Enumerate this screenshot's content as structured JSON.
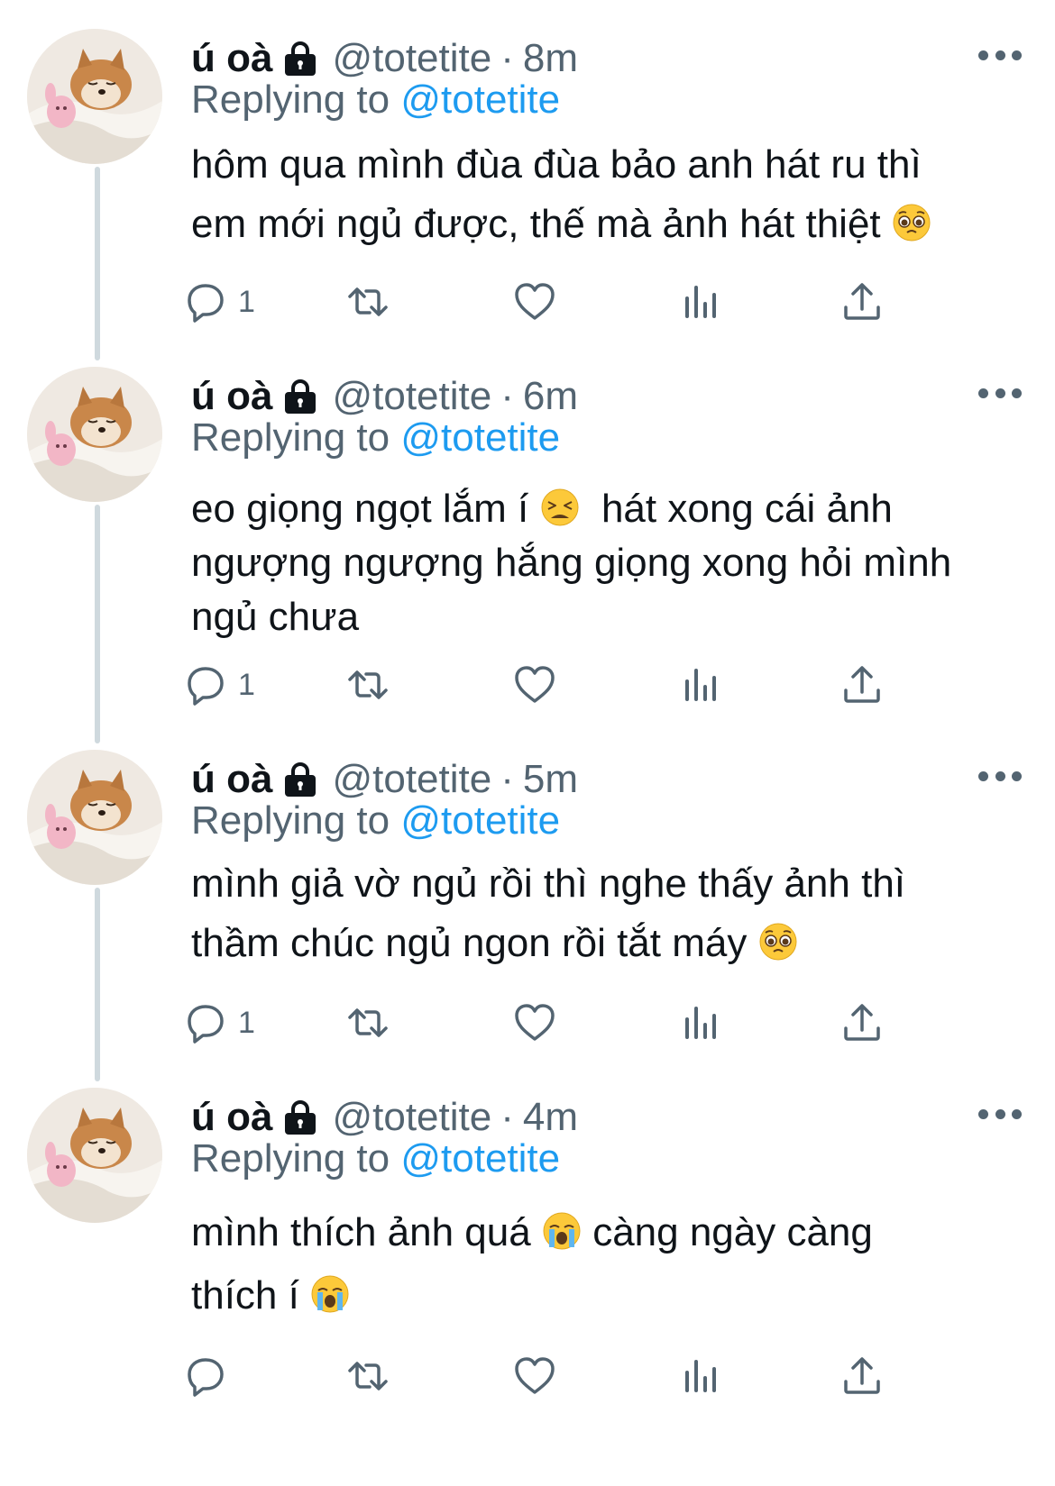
{
  "tweets": [
    {
      "name": "ú oà",
      "handle": "@totetite",
      "sep": "·",
      "time": "8m",
      "reply_prefix": "Replying to",
      "reply_handle": "@totetite",
      "lines": [
        "hôm qua mình đùa đùa bảo anh hát ru thì",
        "em mới ngủ được, thế mà ảnh hát thiệt"
      ],
      "reply_count": "1"
    },
    {
      "name": "ú oà",
      "handle": "@totetite",
      "sep": "·",
      "time": "6m",
      "reply_prefix": "Replying to",
      "reply_handle": "@totetite",
      "lines": [
        "eo giọng ngọt lắm í",
        "hát xong cái ảnh",
        "ngượng ngượng hắng giọng xong hỏi mình",
        "ngủ chưa"
      ],
      "reply_count": "1"
    },
    {
      "name": "ú oà",
      "handle": "@totetite",
      "sep": "·",
      "time": "5m",
      "reply_prefix": "Replying to",
      "reply_handle": "@totetite",
      "lines": [
        "mình giả vờ ngủ rồi thì nghe thấy ảnh thì",
        "thầm chúc ngủ ngon rồi tắt máy"
      ],
      "reply_count": "1"
    },
    {
      "name": "ú oà",
      "handle": "@totetite",
      "sep": "·",
      "time": "4m",
      "reply_prefix": "Replying to",
      "reply_handle": "@totetite",
      "lines": [
        "mình thích ảnh quá",
        "càng ngày càng",
        "thích í"
      ],
      "reply_count": ""
    }
  ],
  "icons": {
    "lock": "lock-icon",
    "more": "more-icon",
    "reply": "reply-icon",
    "retweet": "retweet-icon",
    "like": "like-icon",
    "views": "views-icon",
    "share": "share-icon",
    "pleading_emoji": "pleading-face-emoji",
    "tired_emoji": "tired-face-emoji",
    "crying_emoji": "loudly-crying-face-emoji"
  },
  "colors": {
    "text": "#0f1419",
    "secondary": "#536471",
    "mention": "#1d9bf0",
    "thread_line": "#cfd9de"
  }
}
